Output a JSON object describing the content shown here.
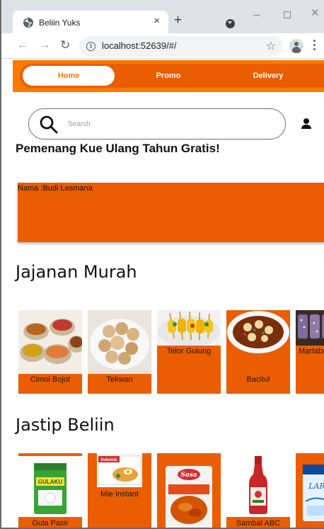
{
  "browser": {
    "tab_title": "Beliin Yuks",
    "tab_close": "×",
    "new_tab": "+",
    "url": "localhost:52639/#/"
  },
  "navbar": {
    "items": [
      {
        "label": "Home",
        "active": true
      },
      {
        "label": "Promo",
        "active": false
      },
      {
        "label": "Delivery",
        "active": false
      }
    ]
  },
  "search": {
    "placeholder": "Search",
    "value": ""
  },
  "winner": {
    "title": "Pemenang Kue Ulang Tahun Gratis!",
    "name_text": "Nama :Budi Lesmana"
  },
  "jajanan": {
    "title": "Jajanan Murah",
    "items": [
      {
        "label": "Cimol Bojot",
        "icon": "cimol-bowls-image"
      },
      {
        "label": "Tekwan",
        "icon": "tekwan-plate-image"
      },
      {
        "label": "Telor Gulung",
        "icon": "telor-gulung-skewers-image"
      },
      {
        "label": "Bacitul",
        "icon": "bacitul-plate-image"
      },
      {
        "label": "Martabak",
        "icon": "martabak-image"
      }
    ]
  },
  "jastip": {
    "title": "Jastip Beliin",
    "items": [
      {
        "label": "Gula Pasir",
        "icon": "gulaku-pack-image",
        "pack_text": "GULAKU"
      },
      {
        "label": "Mie Instant",
        "icon": "indomie-pack-image",
        "pack_text": "Indomie"
      },
      {
        "label": "",
        "icon": "sasa-tepung-pack-image",
        "pack_text": "Sasa"
      },
      {
        "label": "Sambal ABC",
        "icon": "sambal-bottle-image",
        "pack_text": ""
      },
      {
        "label": "",
        "icon": "beras-pack-image",
        "pack_text": ""
      }
    ]
  },
  "colors": {
    "nav_orange": "#fd7a00",
    "card_orange": "#ea5d00",
    "white": "#ffffff"
  }
}
